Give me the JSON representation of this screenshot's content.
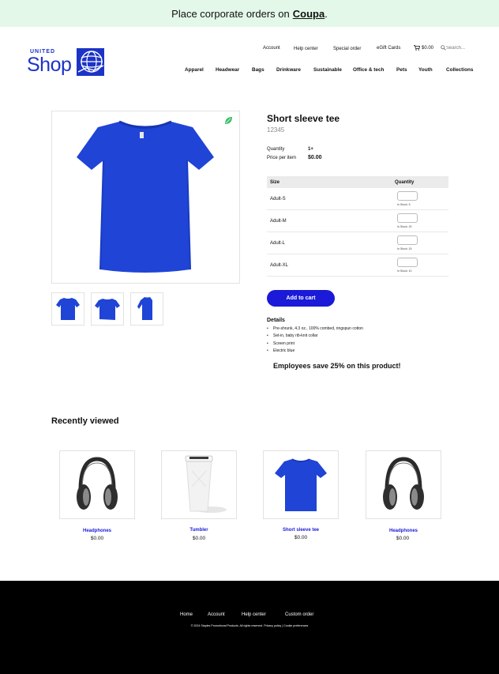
{
  "banner": {
    "text": "Place corporate orders on",
    "link": "Coupa",
    "tail": "."
  },
  "logo": {
    "united": "UNITED",
    "shop": "Shop"
  },
  "topnav": {
    "account": "Account",
    "help": "Help center",
    "special": "Special order",
    "giftcards": "eGift Cards",
    "cart_total": "$0.00",
    "search_placeholder": "Search..."
  },
  "mainnav": [
    "Apparel",
    "Headwear",
    "Bags",
    "Drinkware",
    "Sustainable",
    "Office & tech",
    "Pets",
    "Youth",
    "Collections"
  ],
  "product": {
    "title": "Short sleeve tee",
    "sku": "12345",
    "quantity_label": "Quantity",
    "quantity_value": "1+",
    "price_label": "Price per item",
    "price_value": "$0.00",
    "shirt_color": "#1f44d6",
    "table": {
      "col_size": "Size",
      "col_quantity": "Quantity",
      "rows": [
        {
          "size": "Adult-S",
          "stock": "In Stock: 5"
        },
        {
          "size": "Adult-M",
          "stock": "In Stock: 20"
        },
        {
          "size": "Adult-L",
          "stock": "In Stock: 15"
        },
        {
          "size": "Adult-XL",
          "stock": "In Stock: 10"
        }
      ]
    },
    "add_to_cart": "Add to cart",
    "details_heading": "Details",
    "details": [
      "Pre-shrunk, 4.3 oz., 100% combed, ringspun cotton",
      "Set-in, baby rib-knit collar",
      "Screen print",
      "Electric blue"
    ],
    "promo": "Employees save 25% on this product!"
  },
  "recently_viewed": {
    "title": "Recently viewed",
    "items": [
      {
        "name": "Headphones",
        "price": "$0.00"
      },
      {
        "name": "Tumbler",
        "price": "$0.00"
      },
      {
        "name": "Short sleeve tee",
        "price": "$0.00"
      },
      {
        "name": "Headphones",
        "price": "$0.00"
      }
    ]
  },
  "footer": {
    "links": [
      "Home",
      "Account",
      "Help center",
      "Custom order"
    ],
    "copyright": "© 2024 Staples Promotional Products. All rights reserved. Privacy policy | Cookie preferences"
  },
  "colors": {
    "brand_blue": "#1c34c6",
    "button_blue": "#1a1ad8",
    "banner_green": "#e3f8e8",
    "leaf_green": "#3cc06a"
  }
}
